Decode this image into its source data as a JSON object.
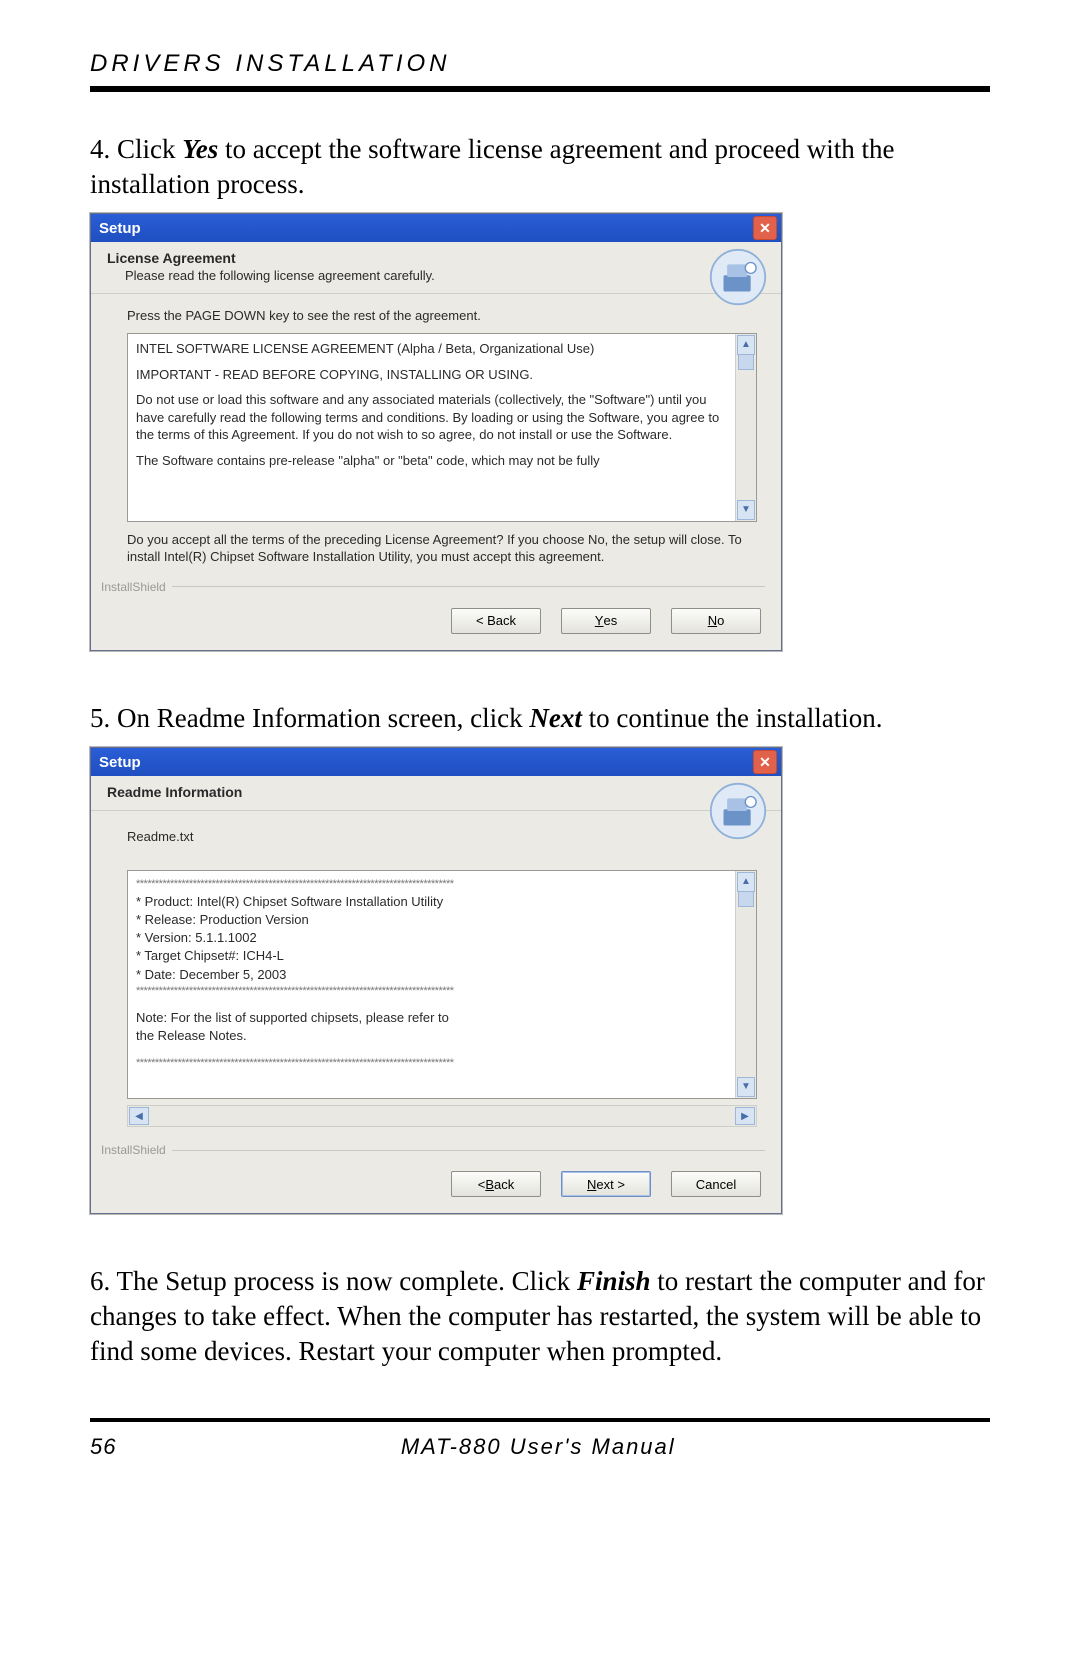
{
  "header": {
    "section_title": "DRIVERS INSTALLATION"
  },
  "step4": {
    "prefix": "4. Click ",
    "bold": "Yes",
    "suffix": " to accept the software license agreement and proceed with the installation process."
  },
  "dialog1": {
    "title": "Setup",
    "wizard_title": "License Agreement",
    "wizard_sub": "Please read the following license agreement carefully.",
    "hint": "Press the PAGE DOWN key to see the rest of the agreement.",
    "license_lines": {
      "l1": "INTEL SOFTWARE LICENSE AGREEMENT (Alpha / Beta, Organizational Use)",
      "l2": "IMPORTANT - READ BEFORE COPYING, INSTALLING OR USING.",
      "l3": "Do not use or load this software and any associated materials (collectively, the \"Software\") until you have carefully read the following terms and conditions. By loading or using the Software, you agree to the terms of this Agreement. If you do not wish to so agree, do not install or use the Software.",
      "l4": "The Software contains pre-release \"alpha\" or \"beta\" code, which may not be fully"
    },
    "accept_q": "Do you accept all the terms of the preceding License Agreement?  If you choose No,  the setup will close.  To install Intel(R) Chipset Software Installation Utility, you must accept this agreement.",
    "brand": "InstallShield",
    "buttons": {
      "back": "< Back",
      "yes_u": "Y",
      "yes_rest": "es",
      "no_u": "N",
      "no_rest": "o"
    }
  },
  "step5": {
    "prefix": "5. On Readme Information screen, click ",
    "bold": "Next",
    "suffix": " to continue the installation."
  },
  "dialog2": {
    "title": "Setup",
    "wizard_title": "Readme Information",
    "label": "Readme.txt",
    "readme_lines": {
      "l1": "*  Product: Intel(R) Chipset Software Installation Utility",
      "l2": "*  Release: Production Version",
      "l3": "*  Version: 5.1.1.1002",
      "l4": "*  Target Chipset#: ICH4-L",
      "l5": "*  Date: December 5, 2003",
      "note1": "Note: For the list of supported chipsets, please refer to",
      "note2": "          the Release Notes."
    },
    "brand": "InstallShield",
    "buttons": {
      "back_u": "B",
      "back_pre": "< ",
      "back_rest": "ack",
      "next_u": "N",
      "next_rest": "ext >",
      "cancel": "Cancel"
    }
  },
  "step6": {
    "prefix": "6. The Setup process is now complete.  Click ",
    "bold": "Finish",
    "suffix": " to restart the computer and for changes to take effect. When the computer has restarted, the system will be able to find some devices. Restart your computer when prompted."
  },
  "footer": {
    "page": "56",
    "title": "MAT-880 User's Manual"
  }
}
